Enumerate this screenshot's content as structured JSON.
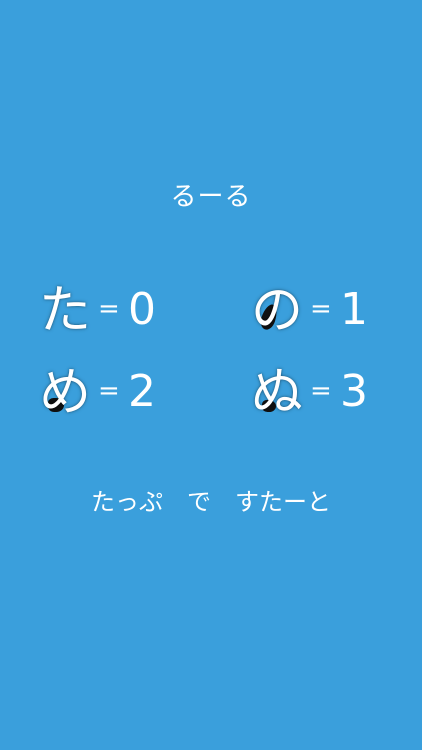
{
  "title": "るーる",
  "rules": [
    {
      "glyph": "た",
      "eq": "=",
      "value": "0"
    },
    {
      "glyph": "の",
      "eq": "=",
      "value": "1"
    },
    {
      "glyph": "め",
      "eq": "=",
      "value": "2"
    },
    {
      "glyph": "ぬ",
      "eq": "=",
      "value": "3"
    }
  ],
  "start_label": "たっぷ　で　すたーと",
  "colors": {
    "background": "#3a9fdc",
    "text": "#ffffff",
    "glyph_fill": "#111111"
  }
}
